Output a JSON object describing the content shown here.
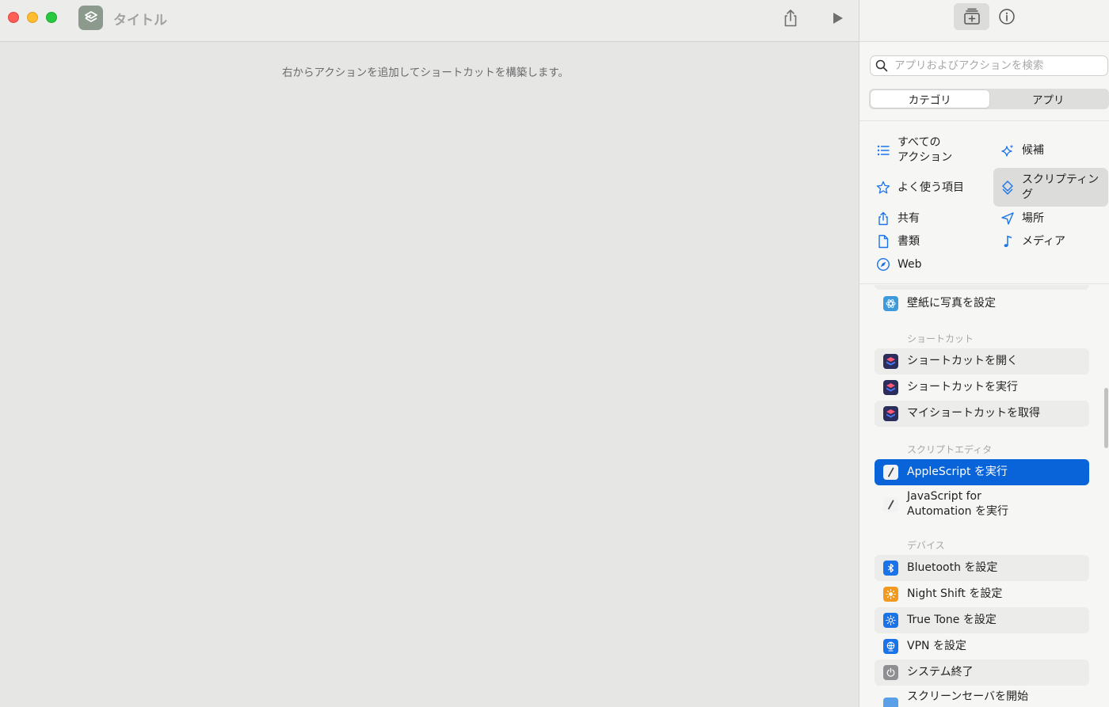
{
  "window": {
    "title": "タイトル"
  },
  "editor": {
    "hint": "右からアクションを追加してショートカットを構築します。"
  },
  "sidebar": {
    "search_placeholder": "アプリおよびアクションを検索",
    "segments": [
      "カテゴリ",
      "アプリ"
    ],
    "active_segment": "カテゴリ",
    "categories": [
      {
        "label": "すべての\nアクション",
        "icon": "list-icon"
      },
      {
        "label": "候補",
        "icon": "sparkle-icon"
      },
      {
        "label": "よく使う項目",
        "icon": "star-icon"
      },
      {
        "label": "スクリプティン\nグ",
        "icon": "scripting-icon",
        "selected": true
      },
      {
        "label": "共有",
        "icon": "share-icon"
      },
      {
        "label": "場所",
        "icon": "location-arrow-icon"
      },
      {
        "label": "書類",
        "icon": "document-icon"
      },
      {
        "label": "メディア",
        "icon": "music-note-icon"
      },
      {
        "label": "Web",
        "icon": "compass-icon"
      }
    ],
    "sections": {
      "shortcuts": "ショートカット",
      "script_editor": "スクリプトエディタ",
      "devices": "デバイス"
    },
    "actions": {
      "wallpaper": "壁紙に写真を設定",
      "open_shortcut": "ショートカットを開く",
      "run_shortcut": "ショートカットを実行",
      "get_my_shortcuts": "マイショートカットを取得",
      "run_applescript": "AppleScript を実行",
      "run_jxa": "JavaScript for\nAutomation を実行",
      "set_bluetooth": "Bluetooth を設定",
      "set_night_shift": "Night Shift を設定",
      "set_true_tone": "True Tone を設定",
      "set_vpn": "VPN を設定",
      "shutdown": "システム終了",
      "start_screensaver": "スクリーンセーバを開始"
    },
    "colors": {
      "selected": "#0a64d9",
      "accent": "#0a64d9"
    }
  }
}
